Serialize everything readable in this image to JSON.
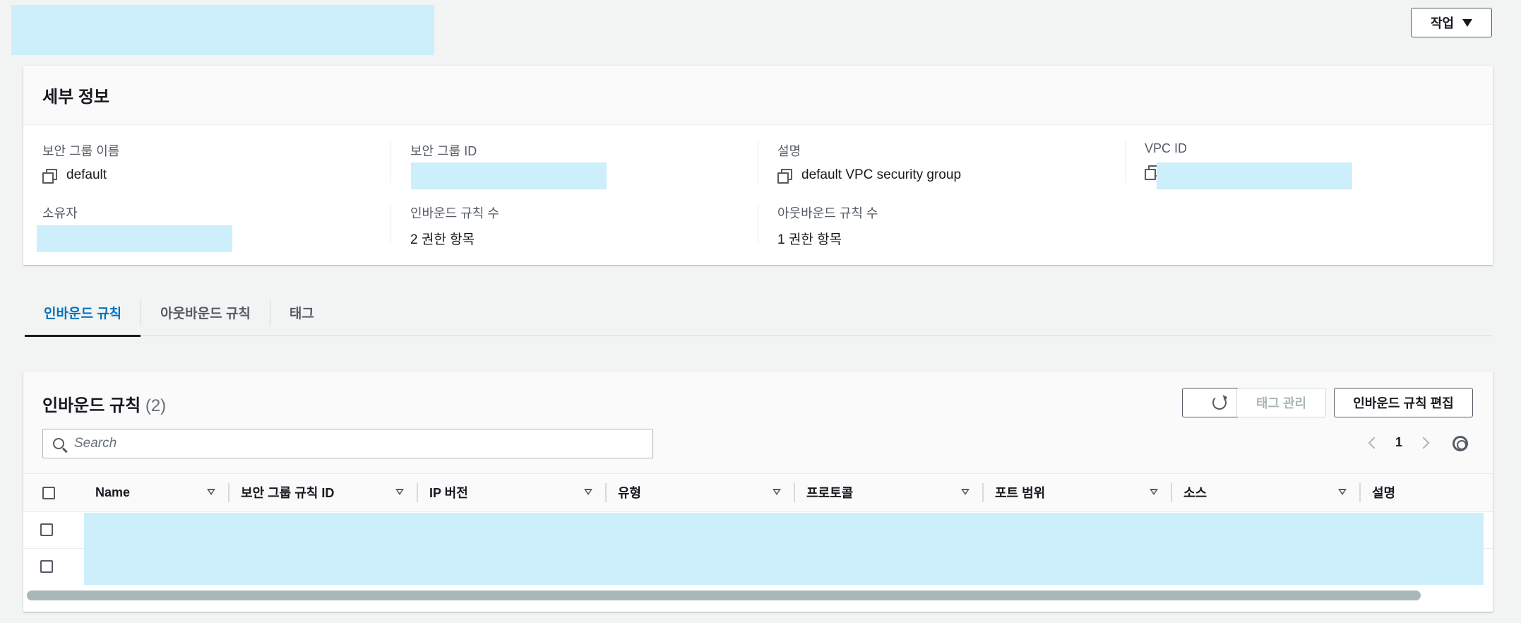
{
  "header": {
    "actions_label": "작업"
  },
  "details": {
    "title": "세부 정보",
    "fields": {
      "sg_name": {
        "label": "보안 그룹 이름",
        "value": "default"
      },
      "sg_id": {
        "label": "보안 그룹 ID"
      },
      "description": {
        "label": "설명",
        "value": "default VPC security group"
      },
      "vpc_id": {
        "label": "VPC ID"
      },
      "owner": {
        "label": "소유자"
      },
      "inbound_count": {
        "label": "인바운드 규칙 수",
        "value": "2 권한 항목"
      },
      "outbound_count": {
        "label": "아웃바운드 규칙 수",
        "value": "1 권한 항목"
      }
    }
  },
  "tabs": [
    {
      "label": "인바운드 규칙",
      "active": true
    },
    {
      "label": "아웃바운드 규칙",
      "active": false
    },
    {
      "label": "태그",
      "active": false
    }
  ],
  "rules": {
    "title": "인바운드 규칙",
    "count": "(2)",
    "manage_tags_label": "태그 관리",
    "edit_label": "인바운드 규칙 편집",
    "search_placeholder": "Search",
    "page": "1",
    "columns": [
      "Name",
      "보안 그룹 규칙 ID",
      "IP 버전",
      "유형",
      "프로토콜",
      "포트 범위",
      "소스",
      "설명"
    ]
  },
  "colors": {
    "accent": "#0073bb",
    "redaction": "#cceffb",
    "background": "#f2f3f3"
  }
}
